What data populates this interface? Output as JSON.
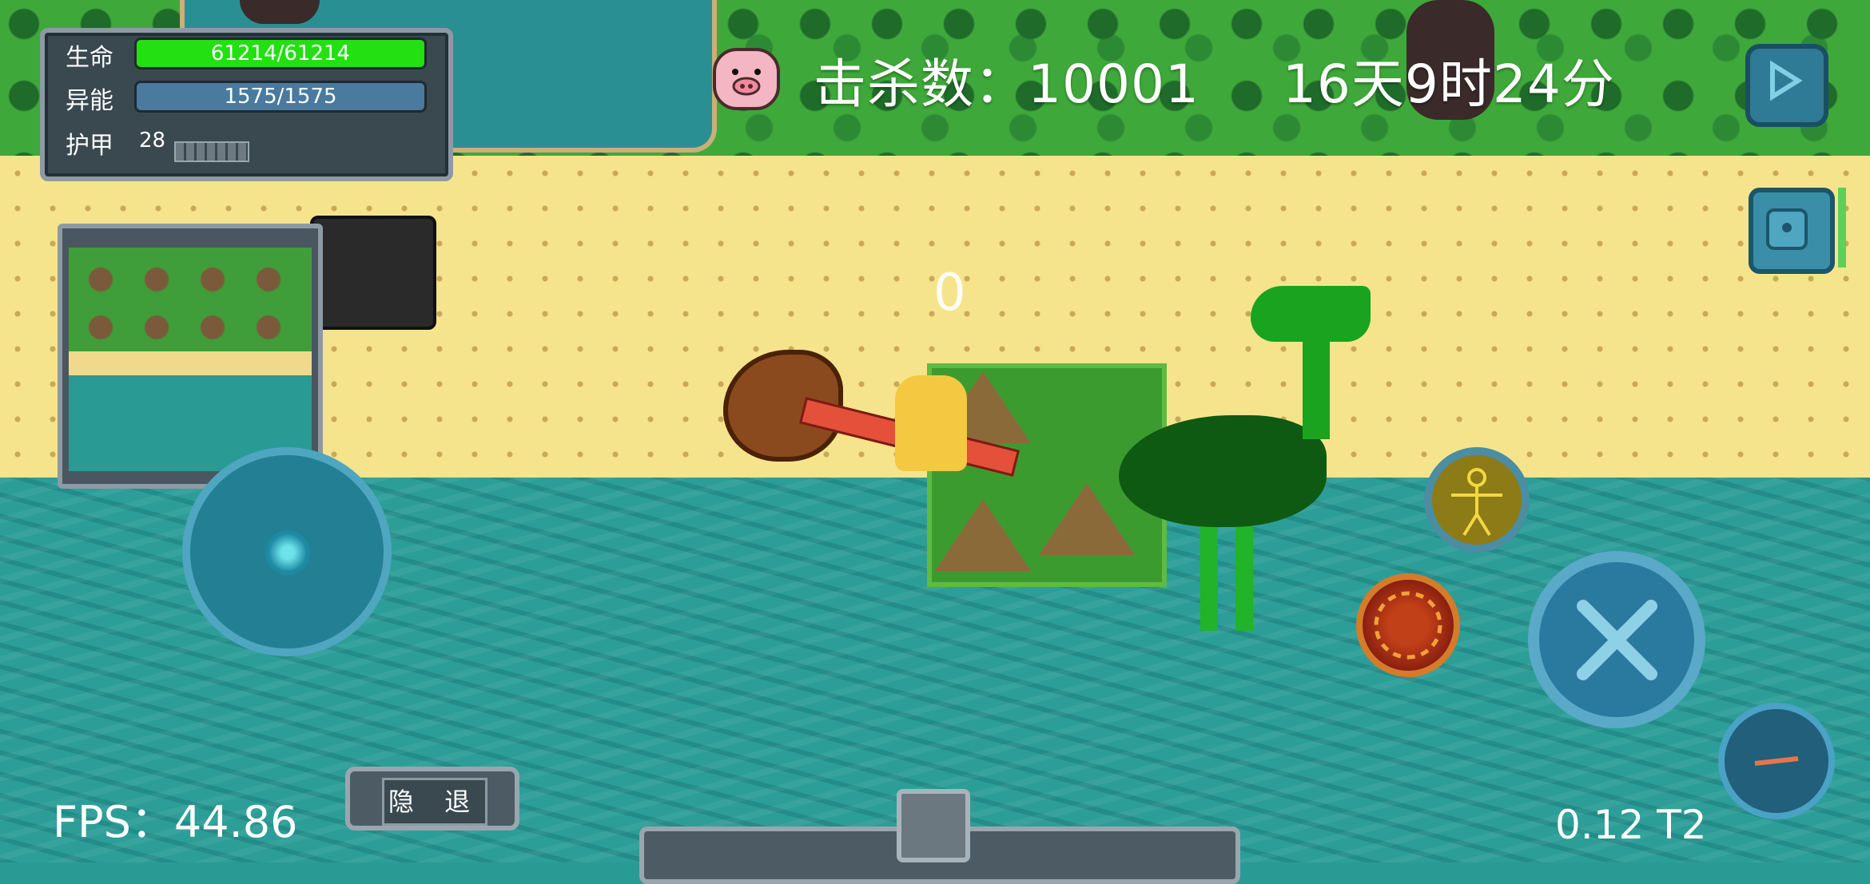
{
  "stats": {
    "hp_label": "生命",
    "hp_value": "61214/61214",
    "hp_fraction": 1.0,
    "energy_label": "异能",
    "energy_value": "1575/1575",
    "energy_fraction": 1.0,
    "armor_label": "护甲",
    "armor_value": "28",
    "hp_color": "#22e012",
    "energy_color": "#4a7a9e"
  },
  "hud": {
    "kills_text": "击杀数：10001",
    "time_text": "16天9时24分",
    "damage_number": "0"
  },
  "bottom": {
    "fps_text": "FPS：44.86",
    "retreat_label": "隐 退",
    "version_text": "0.12 T2"
  },
  "icons": {
    "pause": "play-icon",
    "bag": "backpack-icon",
    "skill_gold": "humanoid-skill-icon",
    "skill_fire": "fire-orb-skill-icon",
    "attack": "crossed-swords-icon",
    "weapon": "sword-icon",
    "portrait": "pig-icon"
  }
}
